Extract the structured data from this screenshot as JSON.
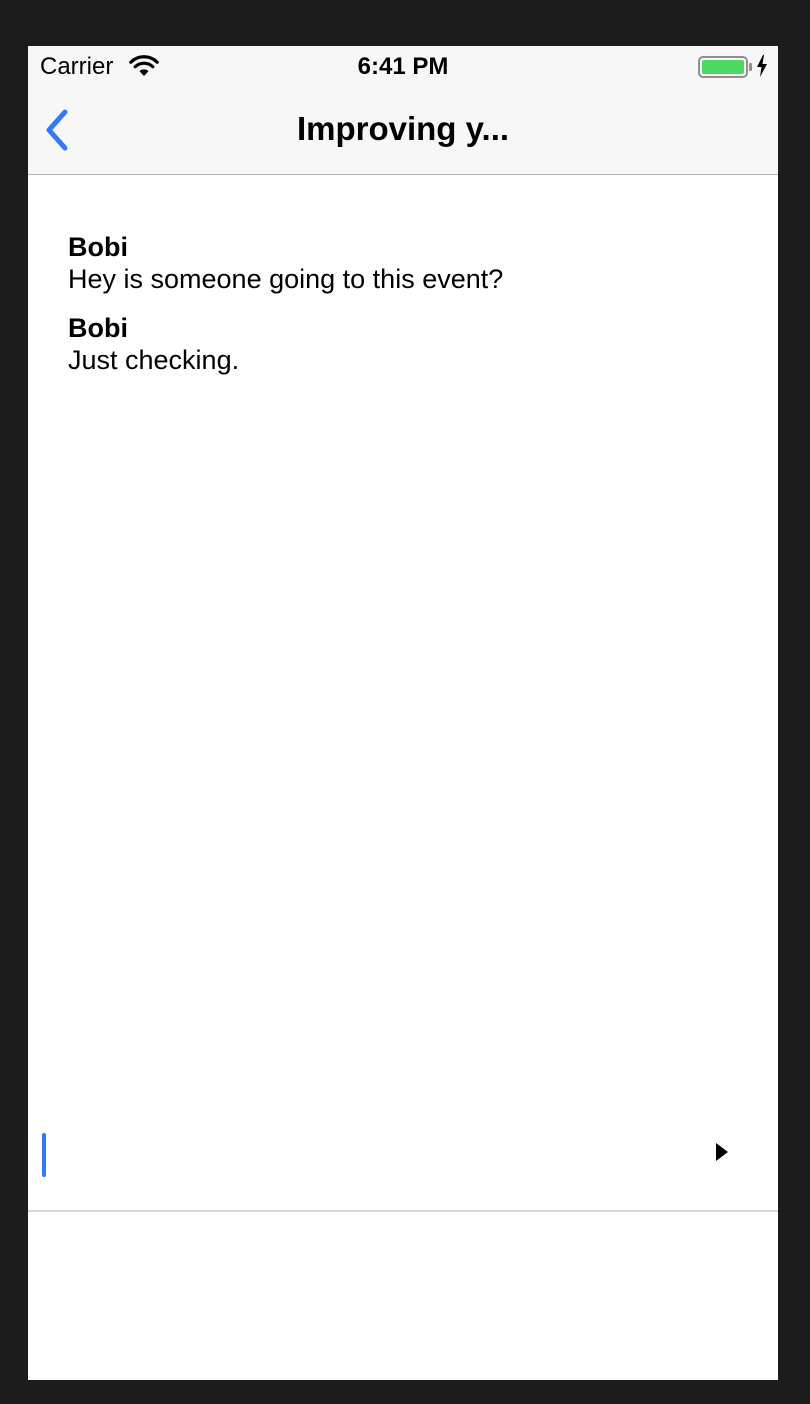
{
  "status_bar": {
    "carrier": "Carrier",
    "time": "6:41 PM",
    "wifi_icon": "wifi-icon",
    "battery_icon": "battery-charging-icon"
  },
  "nav": {
    "title": "Improving y...",
    "back_icon": "chevron-left-icon"
  },
  "colors": {
    "accent": "#3478f6",
    "battery": "#4cd964",
    "chrome": "#f7f7f7"
  },
  "messages": [
    {
      "sender": "Bobi",
      "text": "Hey is someone going to this event?"
    },
    {
      "sender": "Bobi",
      "text": "Just checking."
    }
  ],
  "composer": {
    "value": "",
    "send_icon": "send-triangle-icon"
  }
}
